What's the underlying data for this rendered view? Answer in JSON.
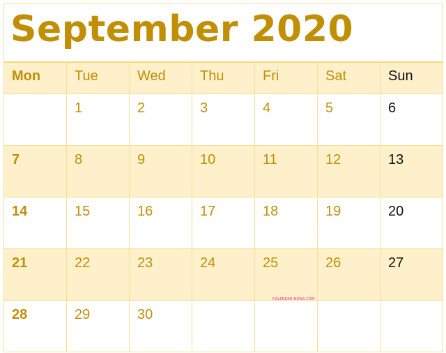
{
  "title": "September 2020",
  "weekdays": [
    "Mon",
    "Tue",
    "Wed",
    "Thu",
    "Fri",
    "Sat",
    "Sun"
  ],
  "weeks": [
    [
      "",
      "1",
      "2",
      "3",
      "4",
      "5",
      "6"
    ],
    [
      "7",
      "8",
      "9",
      "10",
      "11",
      "12",
      "13"
    ],
    [
      "14",
      "15",
      "16",
      "17",
      "18",
      "19",
      "20"
    ],
    [
      "21",
      "22",
      "23",
      "24",
      "25",
      "26",
      "27"
    ],
    [
      "28",
      "29",
      "30",
      "",
      "",
      "",
      ""
    ]
  ],
  "watermark": "CALENDAR-NEWS.COM",
  "colors": {
    "accent": "#c18f06",
    "shade": "#fdf0cb",
    "grid": "#f8df92",
    "sunday": "#111111",
    "watermark": "#e8308a"
  }
}
